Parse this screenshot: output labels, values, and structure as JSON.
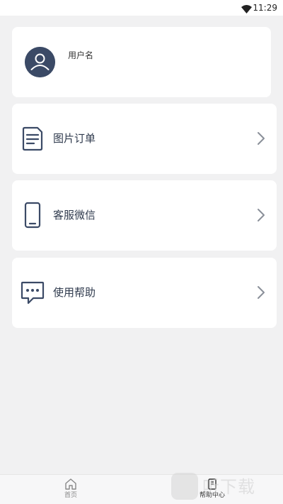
{
  "status_bar": {
    "time": "11:29",
    "icons": [
      "wifi-icon"
    ]
  },
  "profile": {
    "username": "用户名",
    "avatar_icon": "avatar-icon"
  },
  "menu": {
    "items": [
      {
        "label": "图片订单",
        "icon": "order-icon"
      },
      {
        "label": "客服微信",
        "icon": "phone-icon"
      },
      {
        "label": "使用帮助",
        "icon": "chat-icon"
      }
    ]
  },
  "tab_bar": {
    "items": [
      {
        "label": "首页",
        "icon": "home-icon",
        "active": false
      },
      {
        "label": "帮助中心",
        "icon": "help-center-icon",
        "active": true
      }
    ]
  },
  "watermark": {
    "text": "听下载"
  },
  "colors": {
    "background": "#f1f1f2",
    "card": "#ffffff",
    "icon_dark": "#3b4a66",
    "label": "#2f3a4d",
    "chevron": "#8a8f99"
  }
}
